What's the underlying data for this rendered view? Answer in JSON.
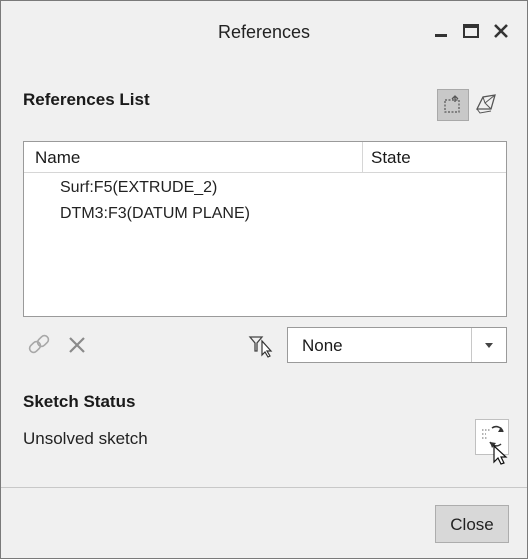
{
  "window": {
    "title": "References",
    "controls": [
      "minimize-icon",
      "maximize-icon",
      "close-icon"
    ]
  },
  "references_list": {
    "label": "References List",
    "toolbar": [
      "select-reference-icon",
      "surface-reference-icon"
    ],
    "columns": {
      "name": "Name",
      "state": "State"
    },
    "rows": [
      {
        "name": "Surf:F5(EXTRUDE_2)",
        "state": ""
      },
      {
        "name": "DTM3:F3(DATUM PLANE)",
        "state": ""
      }
    ]
  },
  "actions": {
    "icons": [
      "link-icon",
      "delete-icon",
      "filter-icon"
    ],
    "filter_value": "None"
  },
  "sketch_status": {
    "label": "Sketch Status",
    "text": "Unsolved sketch",
    "solve_icon": "solve-sketch-icon"
  },
  "footer": {
    "close_label": "Close"
  }
}
